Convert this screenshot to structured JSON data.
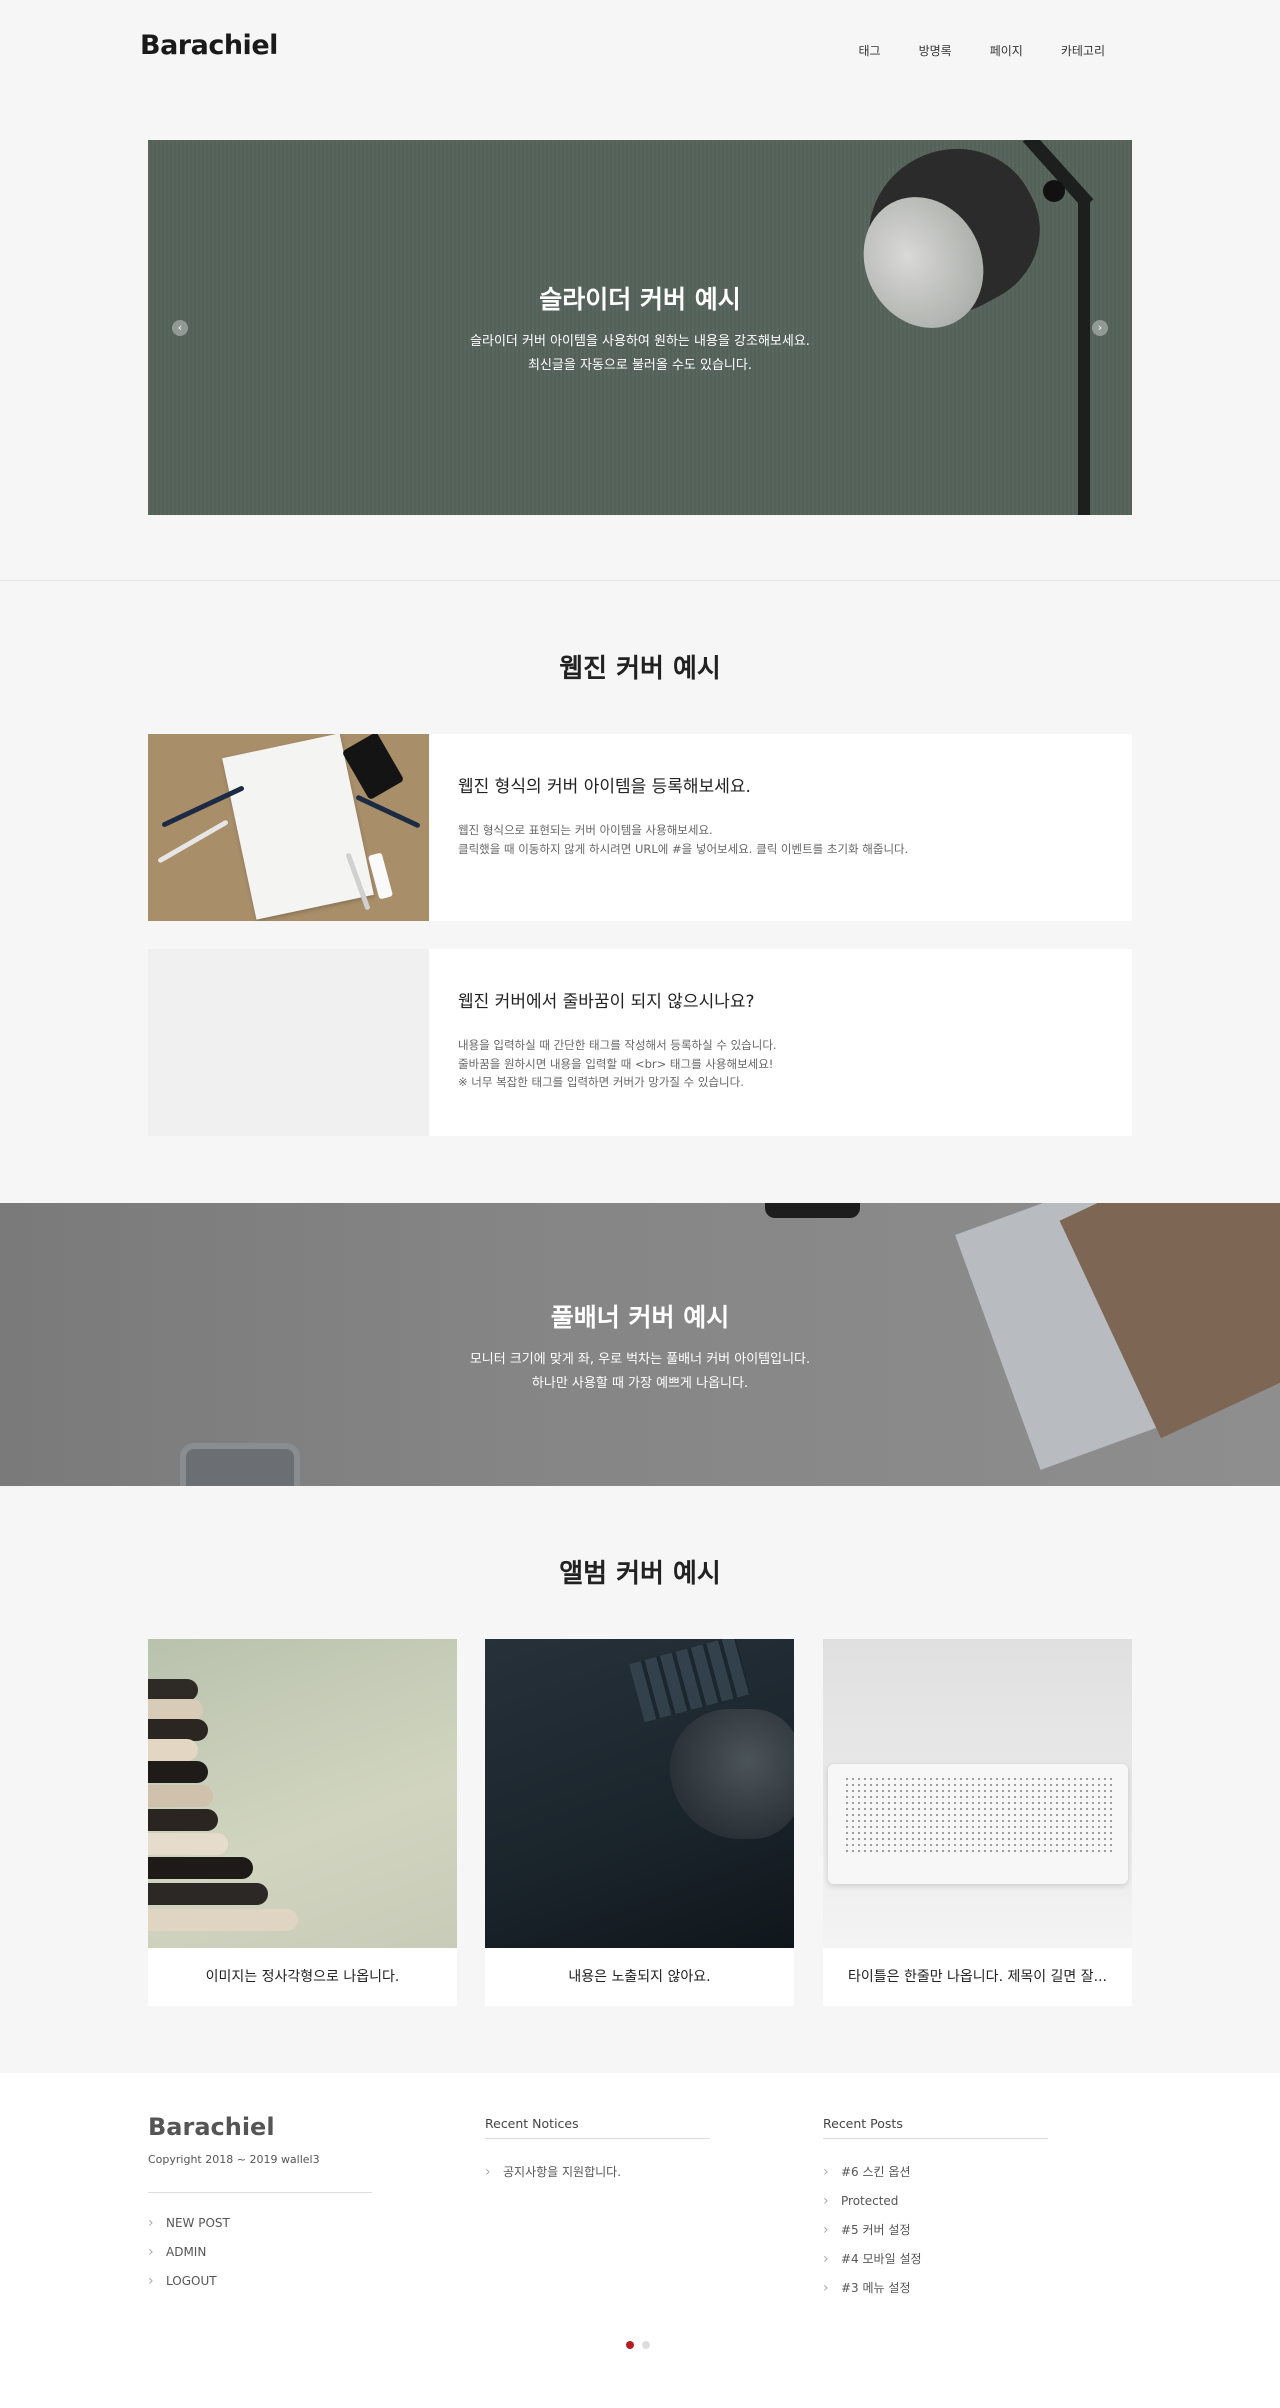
{
  "header": {
    "logo": "Barachiel",
    "nav": [
      "태그",
      "방명록",
      "페이지",
      "카테고리"
    ]
  },
  "slider": {
    "title": "슬라이더 커버 예시",
    "desc_line1": "슬라이더 커버 아이템을 사용하여 원하는 내용을 강조해보세요.",
    "desc_line2": "최신글을 자동으로 불러올 수도 있습니다.",
    "prev_icon": "‹",
    "next_icon": "›"
  },
  "webzine": {
    "title": "웹진 커버 예시",
    "items": [
      {
        "title": "웹진 형식의 커버 아이템을 등록해보세요.",
        "lines": [
          "웹진 형식으로 표현되는 커버 아이템을 사용해보세요.",
          "클릭했을 때 이동하지 않게 하시려면 URL에 #을 넣어보세요. 클릭 이벤트를 초기화 해줍니다."
        ]
      },
      {
        "title": "웹진 커버에서 줄바꿈이 되지 않으시나요?",
        "lines": [
          "내용을 입력하실 때 간단한 태그를 작성해서 등록하실 수 있습니다.",
          "줄바꿈을 원하시면 내용을 입력할 때 <br> 태그를 사용해보세요!",
          "※ 너무 복잡한 태그를 입력하면 커버가 망가질 수 있습니다."
        ]
      }
    ]
  },
  "banner": {
    "title": "풀배너 커버 예시",
    "desc_line1": "모니터 크기에 맞게 좌, 우로 벅차는 풀배너 커버 아이템입니다.",
    "desc_line2": "하나만 사용할 때 가장 예쁘게 나옵니다."
  },
  "album": {
    "title": "앨범 커버 예시",
    "items": [
      {
        "caption": "이미지는 정사각형으로 나옵니다."
      },
      {
        "caption": "내용은 노출되지 않아요."
      },
      {
        "caption": "타이틀은 한줄만 나옵니다. 제목이 길면 잘..."
      }
    ]
  },
  "footer": {
    "logo": "Barachiel",
    "copyright": "Copyright 2018 ~ 2019 wallel3",
    "links": [
      "NEW POST",
      "ADMIN",
      "LOGOUT"
    ],
    "notices_title": "Recent Notices",
    "notices": [
      "공지사항을 지원합니다."
    ],
    "posts_title": "Recent Posts",
    "posts": [
      "#6 스킨 옵션",
      "Protected",
      "#5 커버 설정",
      "#4 모바일 설정",
      "#3 메뉴 설정"
    ]
  },
  "pagination": {
    "active_index": 0,
    "total": 2
  },
  "colors": {
    "accent": "#b32020",
    "background": "#f6f6f6"
  }
}
